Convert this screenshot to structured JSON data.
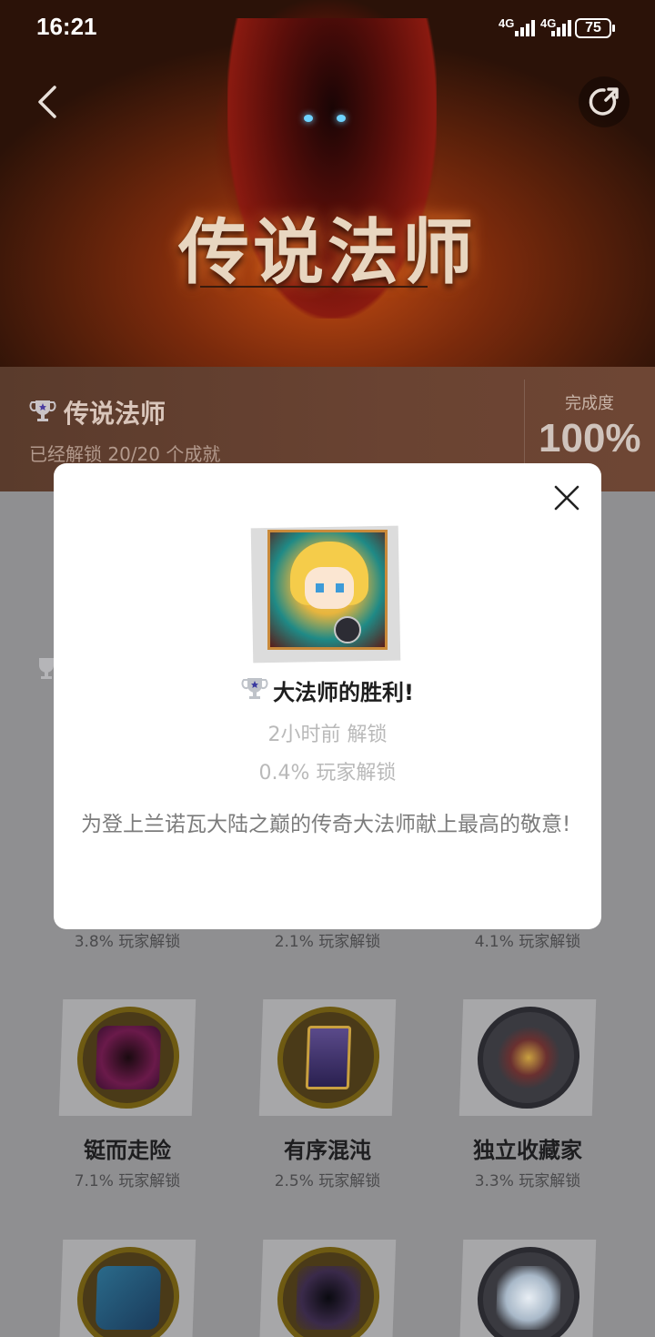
{
  "status_bar": {
    "time": "16:21",
    "network_1": "4G",
    "network_2": "4G",
    "battery": "75"
  },
  "hero": {
    "art_title": "传说法师"
  },
  "header": {
    "icons": {
      "back": "chevron-left-icon",
      "share": "share-icon"
    }
  },
  "game_info": {
    "name": "传说法师",
    "unlocked_text": "已经解锁 20/20 个成就",
    "completion_label": "完成度",
    "completion_value": "100%",
    "progress": 1.0
  },
  "achievements": {
    "row1_pcts": [
      "3.8% 玩家解锁",
      "2.1% 玩家解锁",
      "4.1% 玩家解锁"
    ],
    "row2": [
      {
        "title": "铤而走险",
        "pct": "7.1% 玩家解锁"
      },
      {
        "title": "有序混沌",
        "pct": "2.5% 玩家解锁"
      },
      {
        "title": "独立收藏家",
        "pct": "3.3% 玩家解锁"
      }
    ]
  },
  "modal": {
    "title": "大法师的胜利!",
    "unlock_time": "2小时前 解锁",
    "rate": "0.4% 玩家解锁",
    "description": "为登上兰诺瓦大陆之巅的传奇大法师献上最高的敬意!",
    "icons": {
      "close": "close-icon",
      "trophy": "trophy-icon"
    }
  },
  "colors": {
    "modal_bg": "#ffffff",
    "overlay": "#8f8f91",
    "badge_gold": "#6e5a12",
    "hero_fire": "#c24b12"
  }
}
